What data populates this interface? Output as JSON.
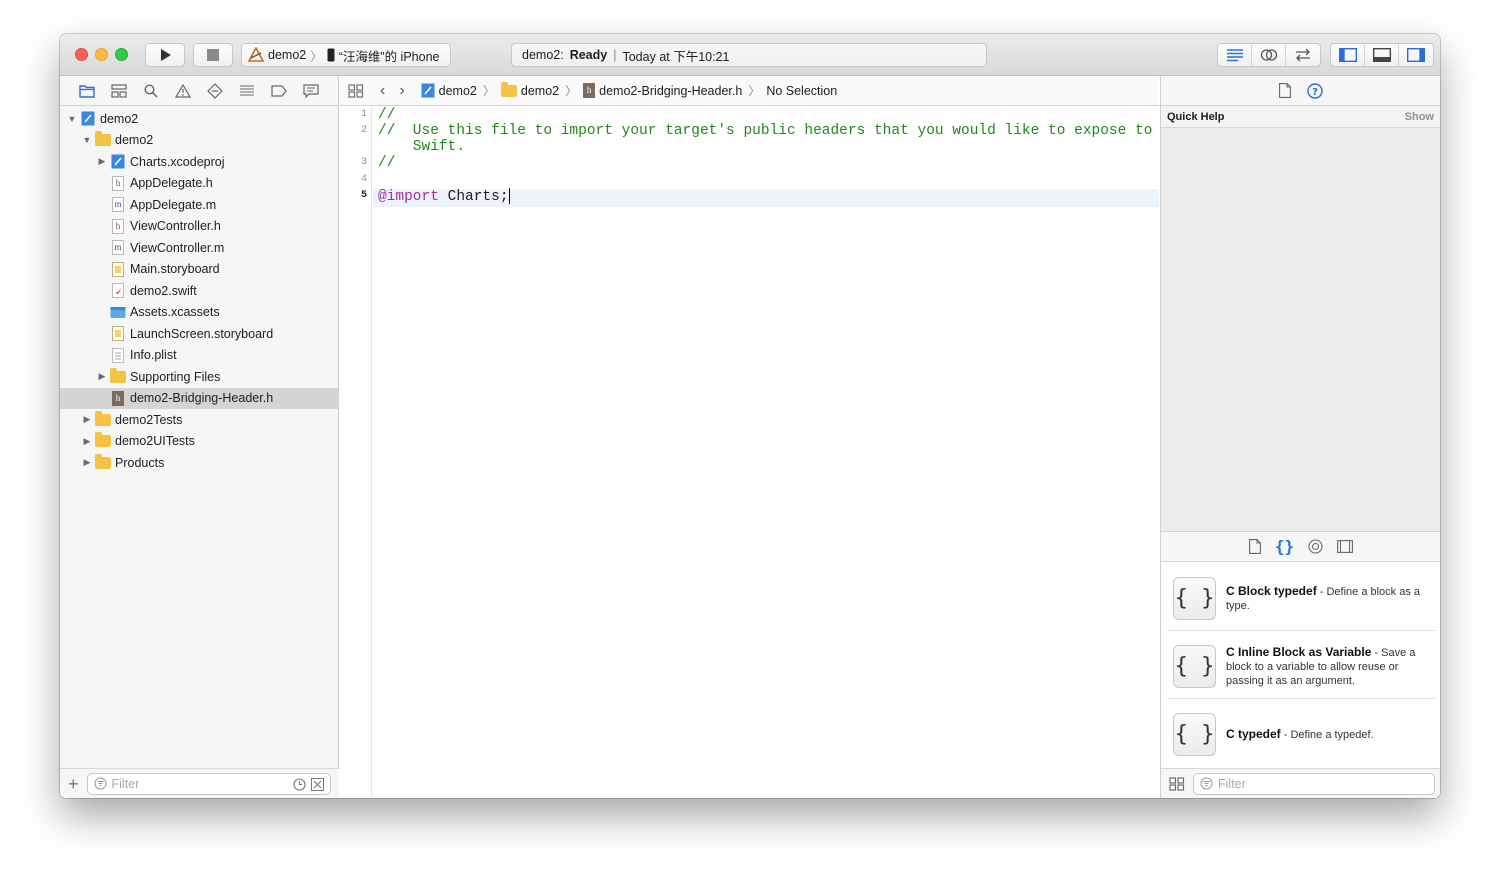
{
  "toolbar": {
    "scheme_project": "demo2",
    "scheme_device": "“汪海维”的 iPhone",
    "activity_project": "demo2:",
    "activity_status": "Ready",
    "activity_separator": "|",
    "activity_time": "Today at 下午10:21"
  },
  "navigator": {
    "tree": [
      {
        "label": "demo2",
        "depth": 0,
        "kind": "project",
        "disclosure": "open"
      },
      {
        "label": "demo2",
        "depth": 1,
        "kind": "folder",
        "disclosure": "open"
      },
      {
        "label": "Charts.xcodeproj",
        "depth": 2,
        "kind": "project",
        "disclosure": "closed"
      },
      {
        "label": "AppDelegate.h",
        "depth": 2,
        "kind": "h"
      },
      {
        "label": "AppDelegate.m",
        "depth": 2,
        "kind": "m"
      },
      {
        "label": "ViewController.h",
        "depth": 2,
        "kind": "h"
      },
      {
        "label": "ViewController.m",
        "depth": 2,
        "kind": "m"
      },
      {
        "label": "Main.storyboard",
        "depth": 2,
        "kind": "storyboard"
      },
      {
        "label": "demo2.swift",
        "depth": 2,
        "kind": "swift"
      },
      {
        "label": "Assets.xcassets",
        "depth": 2,
        "kind": "assets"
      },
      {
        "label": "LaunchScreen.storyboard",
        "depth": 2,
        "kind": "storyboard"
      },
      {
        "label": "Info.plist",
        "depth": 2,
        "kind": "plist"
      },
      {
        "label": "Supporting Files",
        "depth": 2,
        "kind": "folder",
        "disclosure": "closed"
      },
      {
        "label": "demo2-Bridging-Header.h",
        "depth": 2,
        "kind": "h",
        "selected": true
      },
      {
        "label": "demo2Tests",
        "depth": 1,
        "kind": "folder",
        "disclosure": "closed"
      },
      {
        "label": "demo2UITests",
        "depth": 1,
        "kind": "folder",
        "disclosure": "closed"
      },
      {
        "label": "Products",
        "depth": 1,
        "kind": "folder",
        "disclosure": "closed"
      }
    ],
    "filter_placeholder": "Filter"
  },
  "editor": {
    "breadcrumb": [
      "demo2",
      "demo2",
      "demo2-Bridging-Header.h",
      "No Selection"
    ],
    "line_numbers": [
      "1",
      "2",
      "3",
      "4",
      "5"
    ],
    "lines": {
      "l1": "//",
      "l2a": "//  Use this file to import your target's public headers that you would like to expose to",
      "l2b": "    Swift.",
      "l3": "//",
      "l5_kw": "@import",
      "l5_rest": " Charts;"
    }
  },
  "inspector": {
    "quick_help_title": "Quick Help",
    "quick_help_action": "Show",
    "library_items": [
      {
        "icon": "{ }",
        "title": "C Block typedef",
        "desc": " - Define a block as a type."
      },
      {
        "icon": "{ }",
        "title": "C Inline Block as Variable",
        "desc": " - Save a block to a variable to allow reuse or passing it as an argument."
      },
      {
        "icon": "{ }",
        "title": "C typedef",
        "desc": " - Define a typedef."
      }
    ],
    "filter_placeholder": "Filter"
  },
  "colors": {
    "accent": "#1a73e8",
    "comment": "#1f8a1a",
    "keyword": "#a02ea8",
    "folder": "#f5c344",
    "selection": "#d4d4d4"
  }
}
